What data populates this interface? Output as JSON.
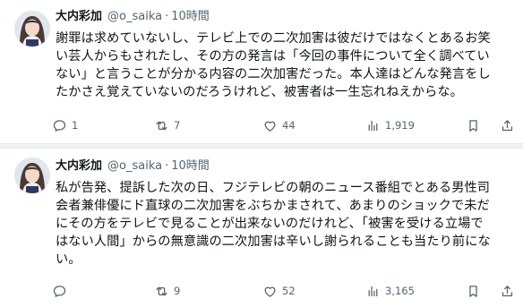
{
  "tweets": [
    {
      "author": {
        "name": "大内彩加",
        "handle": "@o_saika"
      },
      "separator": "·",
      "time": "10時間",
      "lines": [
        "謝罪は求めていないし、テレビ上での二次加害は彼だけではなくとあるお笑",
        "い芸人からもされたし、その方の発言は「今回の事件について全く調べてい",
        "ない」と言うことが分かる内容の二次加害だった。本人達はどんな発言をし",
        "たかさえ覚えていないのだろうけれど、被害者は一生忘れねえからな。"
      ],
      "stats": {
        "replies": "1",
        "reposts": "7",
        "likes": "44",
        "views": "1,919"
      }
    },
    {
      "author": {
        "name": "大内彩加",
        "handle": "@o_saika"
      },
      "separator": "·",
      "time": "10時間",
      "lines": [
        "私が告発、提訴した次の日、フジテレビの朝のニュース番組でとある男性司",
        "会者兼俳優にド直球の二次加害をぶちかまされて、あまりのショックで未だ",
        "にその方をテレビで見ることが出来ないのだけれど、「被害を受ける立場で",
        "はない人間」からの無意識の二次加害は辛いし謝られることも当たり前にな",
        "い。"
      ],
      "stats": {
        "replies": "",
        "reposts": "9",
        "likes": "52",
        "views": "3,165"
      }
    }
  ],
  "icons": {
    "reply": "speech-bubble-icon",
    "repost": "repost-arrows-icon",
    "like": "heart-icon",
    "views": "bar-chart-icon",
    "bookmark": "bookmark-icon",
    "share": "share-upload-icon"
  },
  "colors": {
    "text": "#0f1419",
    "secondary": "#536471",
    "divider": "#eff3f4"
  }
}
